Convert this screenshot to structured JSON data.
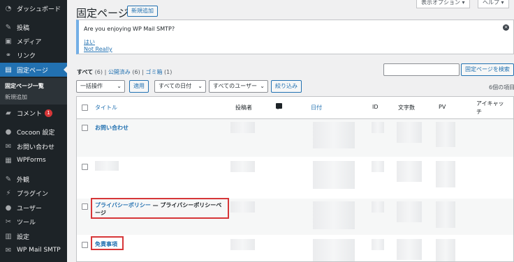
{
  "sidebar": {
    "items": [
      {
        "label": "ダッシュボード",
        "icon": "dashboard-icon",
        "glyph": "◔"
      },
      {
        "label": "投稿",
        "icon": "pin-icon",
        "glyph": "✎"
      },
      {
        "label": "メディア",
        "icon": "media-icon",
        "glyph": "▣"
      },
      {
        "label": "リンク",
        "icon": "link-icon",
        "glyph": "⚭"
      },
      {
        "label": "固定ページ",
        "icon": "pages-icon",
        "glyph": "▤"
      },
      {
        "label": "コメント",
        "icon": "comment-icon",
        "glyph": "▰",
        "badge": "1"
      },
      {
        "label": "Cocoon 設定",
        "icon": "cocoon-icon",
        "glyph": "●"
      },
      {
        "label": "お問い合わせ",
        "icon": "mail-icon",
        "glyph": "✉"
      },
      {
        "label": "WPForms",
        "icon": "forms-icon",
        "glyph": "▦"
      },
      {
        "label": "外観",
        "icon": "brush-icon",
        "glyph": "✎"
      },
      {
        "label": "プラグイン",
        "icon": "plugin-icon",
        "glyph": "⚡"
      },
      {
        "label": "ユーザー",
        "icon": "user-icon",
        "glyph": "●"
      },
      {
        "label": "ツール",
        "icon": "wrench-icon",
        "glyph": "✂"
      },
      {
        "label": "設定",
        "icon": "settings-icon",
        "glyph": "▥"
      },
      {
        "label": "WP Mail SMTP",
        "icon": "smtp-icon",
        "glyph": "✉"
      }
    ],
    "submenu": [
      "固定ページ一覧",
      "新規追加"
    ]
  },
  "header": {
    "title": "固定ページ",
    "add_new": "新規追加",
    "screen_options": "表示オプション ▾",
    "help": "ヘルプ ▾"
  },
  "notice": {
    "message": "Are you enjoying WP Mail SMTP?",
    "yes": "はい",
    "no": "Not Really",
    "close": "×"
  },
  "views": {
    "all": "すべて",
    "all_count": "(6)",
    "published": "公開済み",
    "published_count": "(6)",
    "trash": "ゴミ箱",
    "trash_count": "(1)",
    "sep": "|"
  },
  "search": {
    "value": "",
    "button": "固定ページを検索"
  },
  "filters": {
    "bulk": "一括操作",
    "apply": "適用",
    "dates": "すべての日付",
    "users": "すべてのユーザー",
    "filter": "絞り込み",
    "count": "6個の項目"
  },
  "table": {
    "columns": {
      "title": "タイトル",
      "author": "投稿者",
      "date": "日付",
      "id": "ID",
      "chars": "文字数",
      "pv": "PV",
      "eyecatch": "アイキャッチ"
    },
    "rows": [
      {
        "title": "お問い合わせ",
        "state": ""
      },
      {
        "title": "",
        "state": ""
      },
      {
        "title": "プライバシーポリシー",
        "state": " — プライバシーポリシーペ",
        "state2": "ージ"
      },
      {
        "title": "免責事項",
        "state": ""
      }
    ]
  },
  "colors": {
    "sidebar_bg": "#1d2327",
    "active": "#2271b1",
    "highlight": "#d63638"
  }
}
